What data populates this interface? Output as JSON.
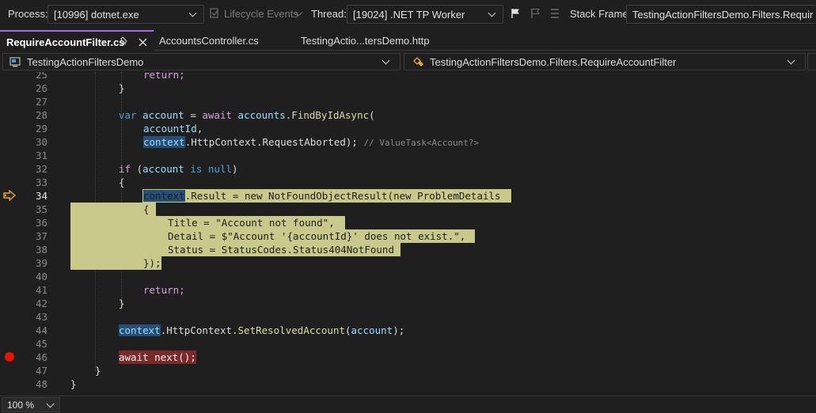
{
  "debug_bar": {
    "process_label": "Process:",
    "process_value": "[10996] dotnet.exe",
    "lifecycle_label": "Lifecycle Events",
    "thread_label": "Thread:",
    "thread_value": "[19024] .NET TP Worker",
    "stack_label": "Stack Frame:",
    "stack_value": "TestingActionFiltersDemo.Filters.Requir"
  },
  "tabs": [
    {
      "label": "RequireAccountFilter.cs",
      "active": true
    },
    {
      "label": "AccountsController.cs",
      "active": false
    },
    {
      "label": "TestingActio...tersDemo.http",
      "active": false
    }
  ],
  "nav": {
    "project": "TestingActionFiltersDemo",
    "type": "TestingActionFiltersDemo.Filters.RequireAccountFilter"
  },
  "lines": [
    "25",
    "26",
    "27",
    "28",
    "29",
    "30",
    "31",
    "32",
    "33",
    "34",
    "35",
    "36",
    "37",
    "38",
    "39",
    "40",
    "41",
    "42",
    "43",
    "44",
    "45",
    "46",
    "47",
    "48"
  ],
  "code": {
    "l25": "return;",
    "l26": "}",
    "l28_var": "var",
    "l28_account": "account",
    "l28_await": "await",
    "l28_accounts": "accounts",
    "l28_fn": "FindByIdAsync",
    "l28_paren": "(",
    "l29_id": "accountId",
    "l29_comma": ",",
    "l30_ctx": "context",
    "l30_rest": ".HttpContext.RequestAborted);",
    "l30_hint": "// ValueTask<Account?>",
    "l32_if": "if",
    "l32_open": " (",
    "l32_account": "account",
    "l32_is": "is",
    "l32_null": "null",
    "l32_close": ")",
    "l33": "{",
    "l34_ctx": "context",
    "l34_rest": ".Result = new NotFoundObjectResult(new ProblemDetails",
    "l35": "{",
    "l36": "Title = \"Account not found\",",
    "l37": "Detail = $\"Account '{accountId}' does not exist.\",",
    "l38": "Status = StatusCodes.Status404NotFound",
    "l39": "});",
    "l41": "return;",
    "l42": "}",
    "l44_ctx": "context",
    "l44_mid": ".HttpContext.",
    "l44_fn": "SetResolvedAccount",
    "l44_open": "(",
    "l44_account": "account",
    "l44_close": ");",
    "l46": "await next();",
    "l47": "}",
    "l48": "}"
  },
  "status": {
    "zoom": "100 %"
  },
  "icons": [
    "chevron-down-icon",
    "lifecycle-icon",
    "flag-icon",
    "pin-icon",
    "close-icon",
    "csharp-project-icon",
    "class-icon",
    "current-statement-arrow-icon",
    "breakpoint-icon"
  ],
  "colors": {
    "accent": "#9f6fe0",
    "breakpoint": "#e51400",
    "statement_highlight": "#c8c98a",
    "context_highlight": "#264f78"
  }
}
